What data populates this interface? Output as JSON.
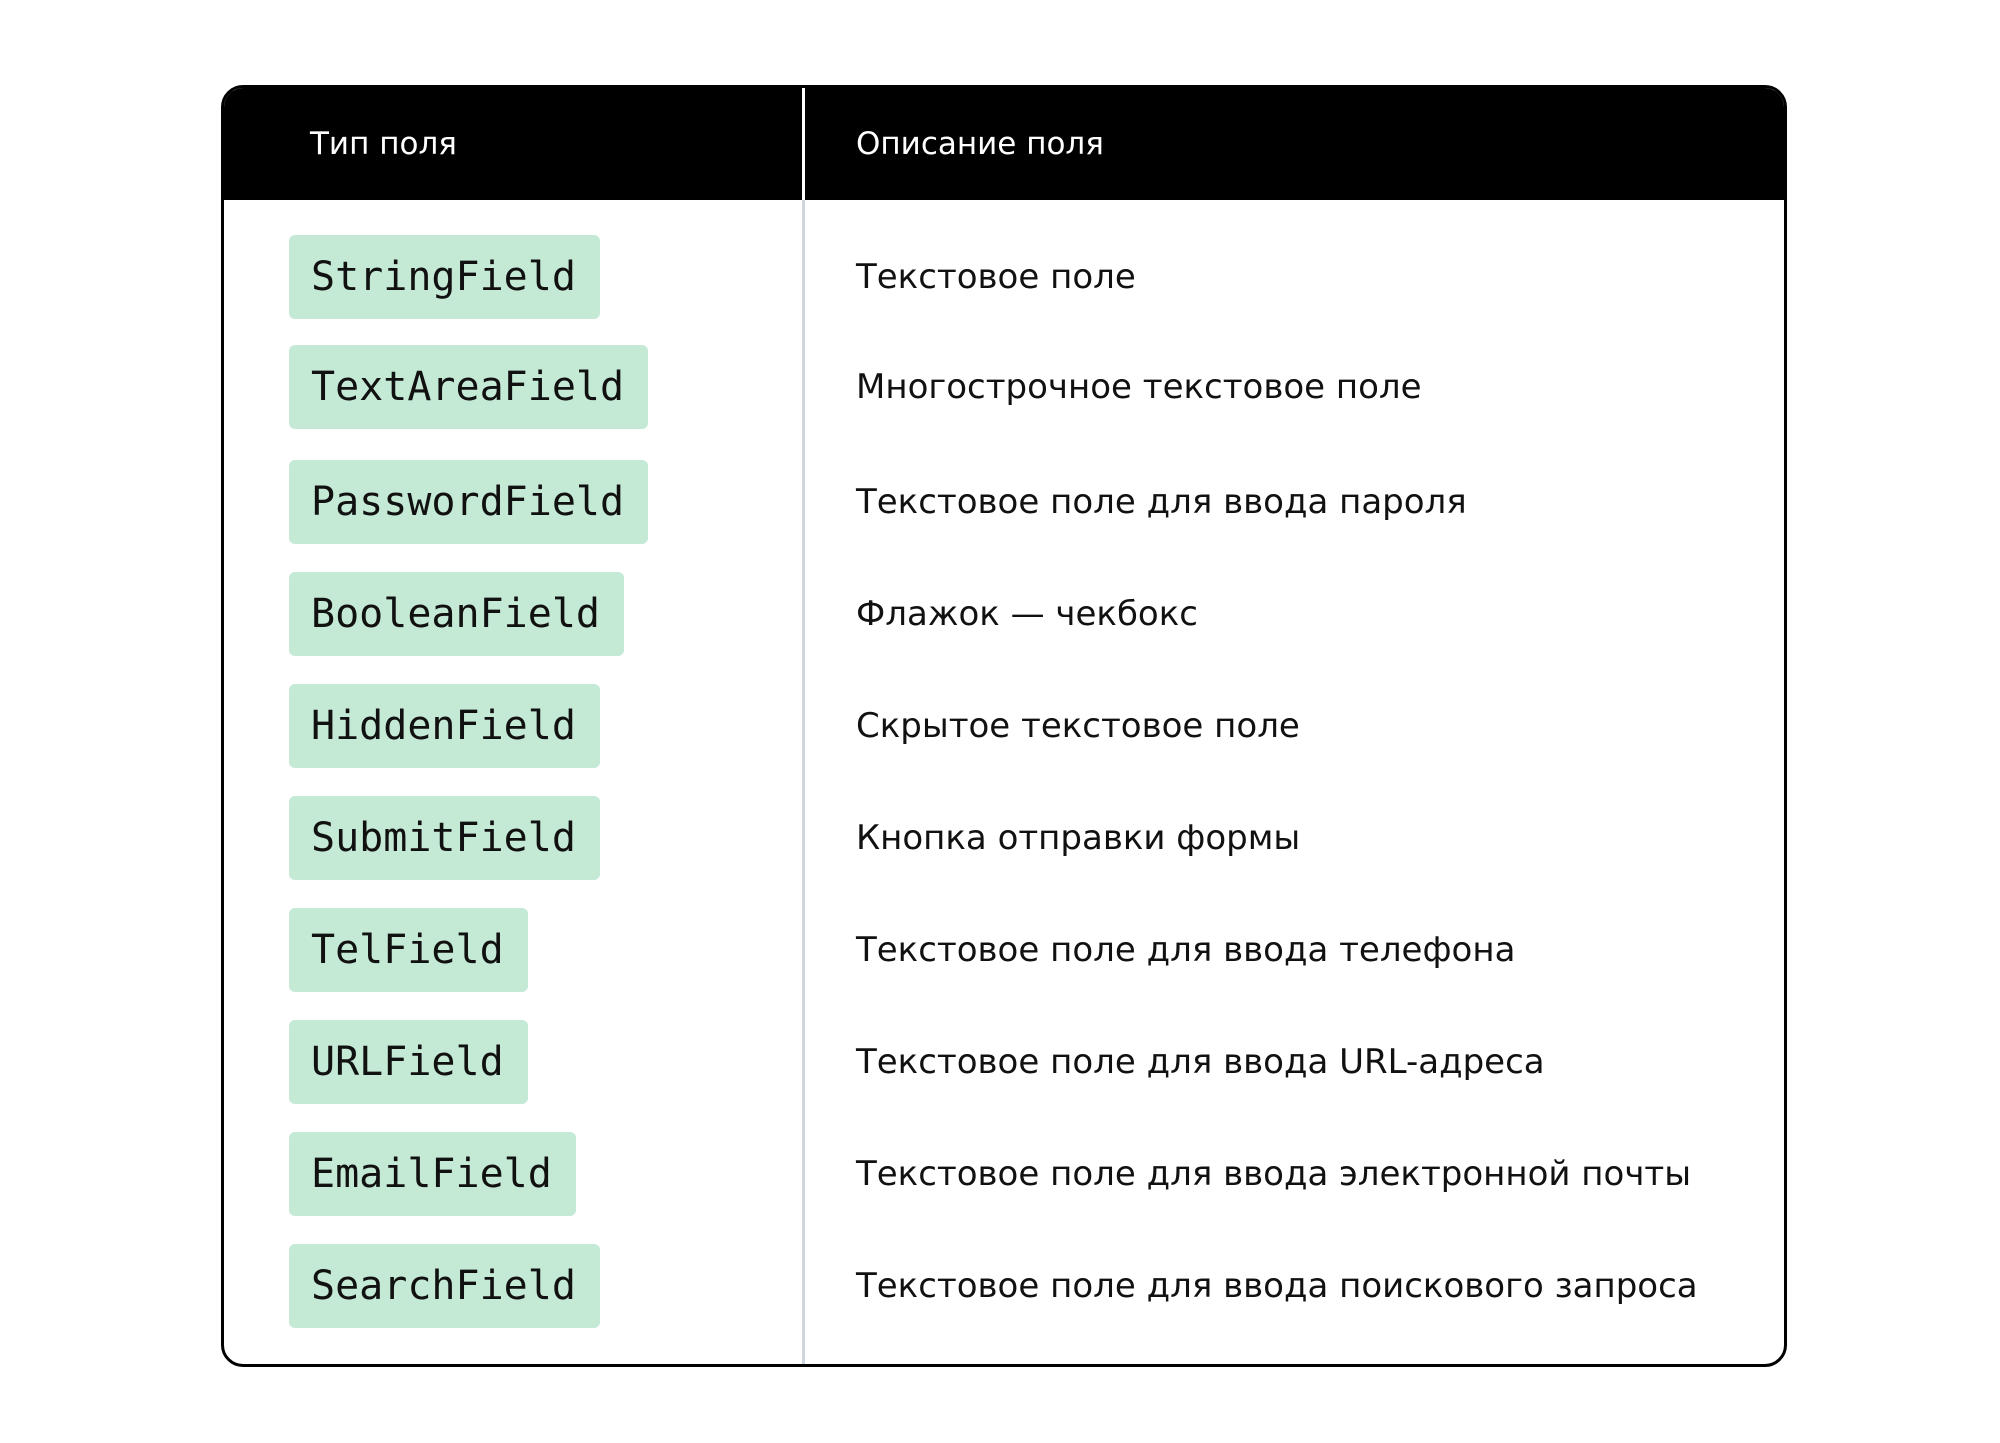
{
  "table": {
    "header": {
      "type_label": "Тип поля",
      "description_label": "Описание поля"
    },
    "rows": [
      {
        "type": "StringField",
        "description": "Текстовое поле"
      },
      {
        "type": "TextAreaField",
        "description": "Многострочное текстовое поле"
      },
      {
        "type": "PasswordField",
        "description": "Текстовое поле для ввода пароля"
      },
      {
        "type": "BooleanField",
        "description": "Флажок — чекбокс"
      },
      {
        "type": "HiddenField",
        "description": "Скрытое текстовое поле"
      },
      {
        "type": "SubmitField",
        "description": "Кнопка отправки формы"
      },
      {
        "type": "TelField",
        "description": "Текстовое поле для ввода телефона"
      },
      {
        "type": "URLField",
        "description": "Текстовое поле для ввода URL-адреса"
      },
      {
        "type": "EmailField",
        "description": "Текстовое поле для ввода электронной почты"
      },
      {
        "type": "SearchField",
        "description": "Текстовое поле для ввода поискового запроса"
      }
    ]
  },
  "colors": {
    "header_background": "#000000",
    "header_text": "#ffffff",
    "chip_background": "#c4ead6",
    "column_divider": "#cfd6de",
    "body_text": "#111111"
  }
}
